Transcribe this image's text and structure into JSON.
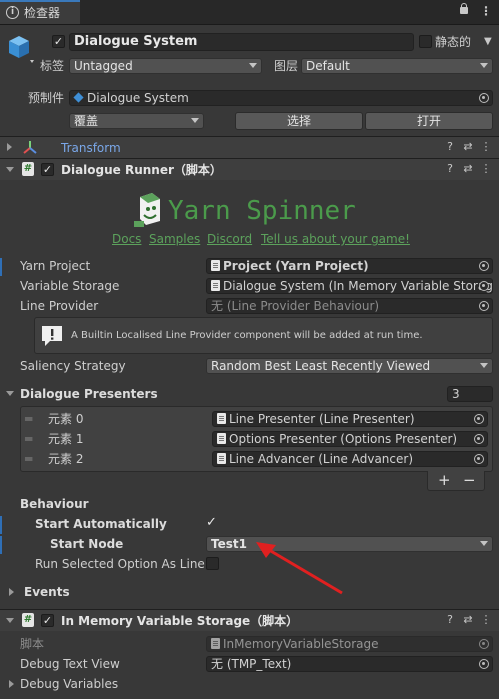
{
  "window": {
    "tab_title": "检查器"
  },
  "header": {
    "object_name": "Dialogue System",
    "static_label": "静态的",
    "tag_label": "标签",
    "tag_value": "Untagged",
    "layer_label": "图层",
    "layer_value": "Default",
    "prefab_label": "预制件",
    "prefab_value": "Dialogue System",
    "override_value": "覆盖",
    "select_button": "选择",
    "open_button": "打开"
  },
  "transform": {
    "title": "Transform"
  },
  "dialogue_runner": {
    "title": "Dialogue Runner（脚本）",
    "logo_text": "Yarn Spinner",
    "links": [
      "Docs",
      "Samples",
      "Discord",
      "Tell us about your game!"
    ],
    "fields": [
      {
        "label": "Yarn Project",
        "value": "Project (Yarn Project)"
      },
      {
        "label": "Variable Storage",
        "value": "Dialogue System (In Memory Variable Storag"
      },
      {
        "label": "Line Provider",
        "value": "无 (Line Provider Behaviour)"
      }
    ],
    "info_message": "A Builtin Localised Line Provider component will be added at run time.",
    "saliency_label": "Saliency Strategy",
    "saliency_value": "Random Best Least Recently Viewed",
    "presenters_label": "Dialogue Presenters",
    "presenters_count": "3",
    "presenters": [
      {
        "label": "元素 0",
        "value": "Line Presenter (Line Presenter)"
      },
      {
        "label": "元素 1",
        "value": "Options Presenter (Options Presenter)"
      },
      {
        "label": "元素 2",
        "value": "Line Advancer (Line Advancer)"
      }
    ],
    "add_button": "+",
    "remove_button": "−",
    "behaviour_label": "Behaviour",
    "start_auto_label": "Start Automatically",
    "start_node_label": "Start Node",
    "start_node_value": "Test1",
    "run_selected_label": "Run Selected Option As Line",
    "events_label": "Events"
  },
  "variable_storage": {
    "title": "In Memory Variable Storage（脚本）",
    "script_label": "脚本",
    "script_value": "InMemoryVariableStorage",
    "debug_text_label": "Debug Text View",
    "debug_text_value": "无 (TMP_Text)",
    "debug_vars_label": "Debug Variables"
  },
  "colors": {
    "accent": "#5ca25c",
    "arrow": "#e02020",
    "transform_title": "#7aa7e8"
  }
}
